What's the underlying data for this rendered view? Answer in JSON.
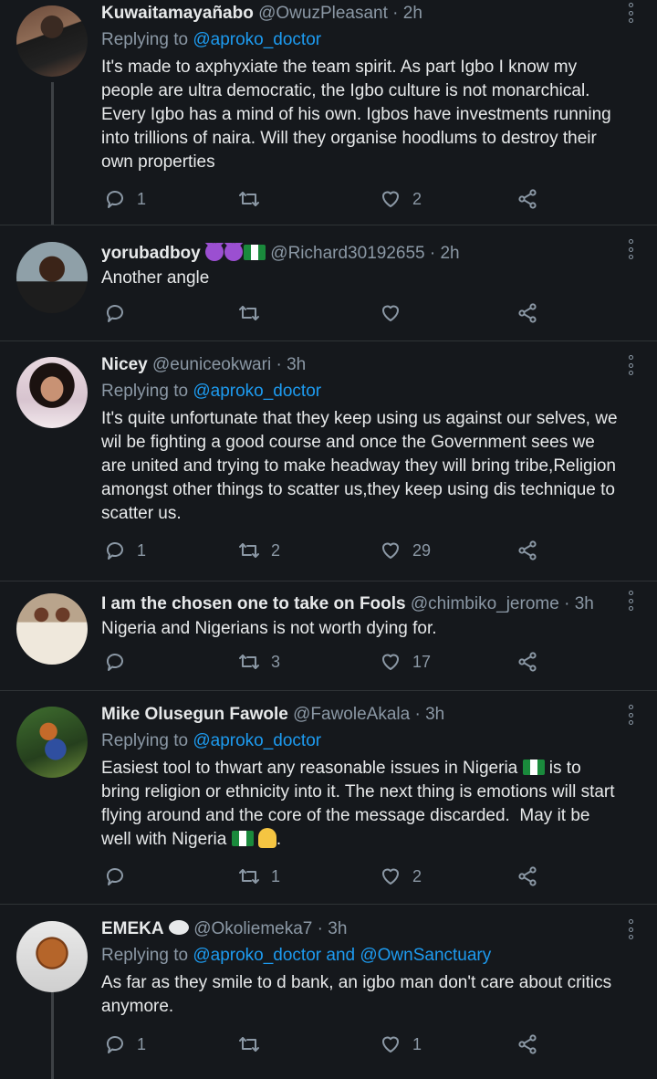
{
  "tweets": [
    {
      "name": "Kuwaitamayañabo",
      "handle": "@OwuzPleasant",
      "time": "2h",
      "replying_prefix": "Replying to ",
      "replying_to": "@aproko_doctor",
      "text": "It's made to axphyxiate the team spirit. As part Igbo I know my people are ultra democratic, the Igbo culture is not monarchical. Every Igbo has a mind of his own. Igbos have investments running into trillions of naira. Will they organise hoodlums to destroy their own properties",
      "replies": "1",
      "retweets": "",
      "likes": "2"
    },
    {
      "name": "yorubadboy",
      "handle": "@Richard30192655",
      "time": "2h",
      "text": "Another angle",
      "replies": "",
      "retweets": "",
      "likes": ""
    },
    {
      "name": "Nicey",
      "handle": "@euniceokwari",
      "time": "3h",
      "replying_prefix": "Replying to ",
      "replying_to": "@aproko_doctor",
      "text": "It's quite unfortunate that they keep using us against our selves, we wil be fighting a good course and once the Government sees we are united and trying to make headway they will bring tribe,Religion amongst other things to scatter us,they keep using dis technique to scatter us.",
      "replies": "1",
      "retweets": "2",
      "likes": "29"
    },
    {
      "name": "I am the chosen one to take on Fools",
      "handle": "@chimbiko_jerome",
      "time": "3h",
      "text": "Nigeria and Nigerians is not worth dying for.",
      "replies": "",
      "retweets": "3",
      "likes": "17"
    },
    {
      "name": "Mike Olusegun Fawole",
      "handle": "@FawoleAkala",
      "time": "3h",
      "replying_prefix": "Replying to ",
      "replying_to": "@aproko_doctor",
      "text_1": "Easiest tool to thwart any reasonable issues in Nigeria ",
      "text_2": " is to bring religion or ethnicity into it. The next thing is emotions will start flying around and the core of the message discarded.  May it be well with Nigeria ",
      "text_3": ".",
      "replies": "",
      "retweets": "1",
      "likes": "2"
    },
    {
      "name": "EMEKA",
      "handle": "@Okoliemeka7",
      "time": "3h",
      "replying_prefix": "Replying to ",
      "replying_to": "@aproko_doctor and @OwnSanctuary",
      "text": "As far as they smile to d bank, an igbo man don't care about critics anymore.",
      "replies": "1",
      "retweets": "",
      "likes": "1"
    }
  ],
  "separator": " · ",
  "colors": {
    "background": "#15181c",
    "link": "#1d9bf0",
    "muted": "#8b98a5",
    "text": "#e7e9ea"
  }
}
